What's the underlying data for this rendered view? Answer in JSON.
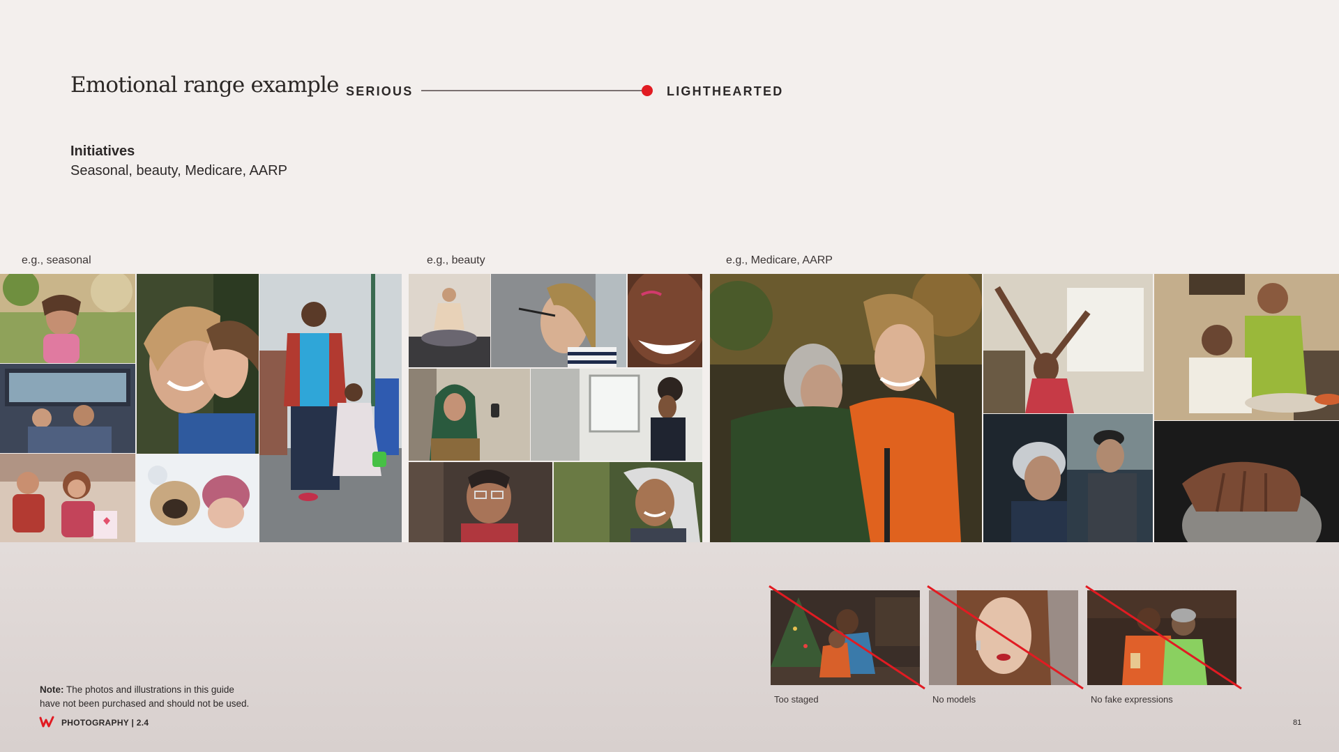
{
  "header": {
    "title": "Emotional range example",
    "scale_left": "SERIOUS",
    "scale_right": "LIGHTHEARTED",
    "scale_level": 1.0
  },
  "initiatives": {
    "heading": "Initiatives",
    "text": "Seasonal, beauty, Medicare, AARP"
  },
  "categories": {
    "seasonal": "e.g., seasonal",
    "beauty": "e.g., beauty",
    "medicare": "e.g., Medicare, AARP"
  },
  "donts": [
    {
      "label": "Too staged"
    },
    {
      "label": "No models"
    },
    {
      "label": "No fake expressions"
    }
  ],
  "note": {
    "bold": "Note:",
    "line1": " The photos and illustrations in this guide",
    "line2": "have not been purchased and should not be used."
  },
  "footer": {
    "section": "PHOTOGRAPHY | 2.4",
    "page": "81"
  },
  "colors": {
    "accent_red": "#e11b22",
    "page_bg": "#f3efed"
  }
}
